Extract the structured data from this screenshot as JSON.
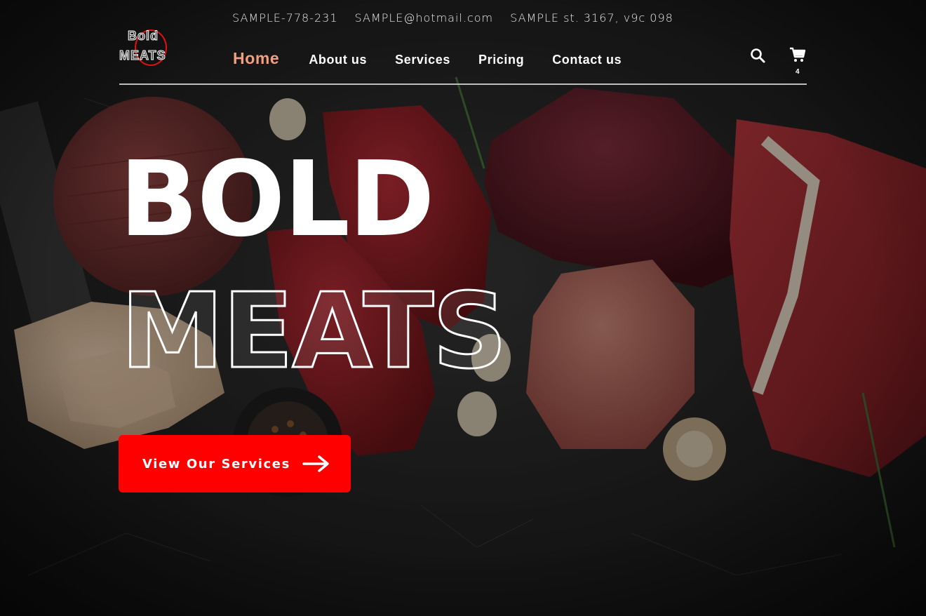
{
  "contact": {
    "phone": "SAMPLE-778-231",
    "email": "SAMPLE@hotmail.com",
    "address": "SAMPLE st. 3167, v9c 098"
  },
  "logo": {
    "line1": "Bold",
    "line2": "MEATS"
  },
  "nav": {
    "items": [
      {
        "label": "Home",
        "active": true
      },
      {
        "label": "About us"
      },
      {
        "label": "Services"
      },
      {
        "label": "Pricing"
      },
      {
        "label": "Contact us"
      }
    ]
  },
  "header": {
    "search_icon": "search-icon",
    "cart_icon": "cart-icon",
    "cart_count": "4"
  },
  "hero": {
    "title_line1": "BOLD",
    "title_line2": "MEATS"
  },
  "cta": {
    "label": "View Our Services",
    "icon": "arrow-right-icon"
  },
  "colors": {
    "accent": "#ff0000",
    "active_nav": "#f0a080",
    "background": "#1c1c1c"
  }
}
